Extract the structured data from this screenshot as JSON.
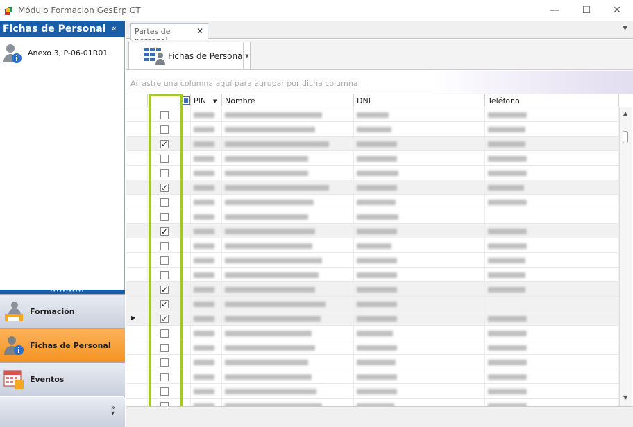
{
  "window": {
    "title": "Módulo Formacion GesErp GT",
    "controls": [
      "minimize",
      "maximize",
      "close"
    ]
  },
  "left_panel": {
    "header": "Fichas de Personal",
    "items": [
      {
        "label": "Anexo 3, P-06-01R01",
        "icon": "person-info-icon"
      }
    ],
    "nav": [
      {
        "label": "Formación",
        "icon": "person-desk-icon",
        "active": false
      },
      {
        "label": "Fichas de Personal",
        "icon": "person-info-icon",
        "active": true
      },
      {
        "label": "Eventos",
        "icon": "calendar-icon",
        "active": false
      }
    ]
  },
  "tabs": [
    {
      "label": "Partes de personal.",
      "closable": true
    }
  ],
  "toolbar": {
    "button_label": "Fichas de Personal"
  },
  "grid": {
    "group_hint": "Arrastre una columna aquí para agrupar por dicha columna",
    "columns": [
      "PIN",
      "Nombre",
      "DNI",
      "Teléfono"
    ],
    "sorted_column": "PIN",
    "checked_rows": [
      false,
      false,
      true,
      false,
      false,
      true,
      false,
      false,
      true,
      false,
      false,
      false,
      true,
      true,
      true,
      false,
      false,
      false,
      false,
      false,
      false
    ],
    "current_row_index": 14,
    "cell_values_obscured": true
  },
  "colors": {
    "accent": "#1b5ea8",
    "active_nav": "#f59322",
    "highlight": "#a3c928"
  }
}
